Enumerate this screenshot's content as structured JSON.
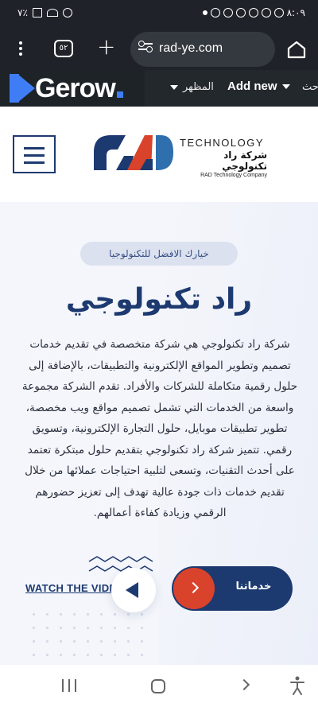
{
  "statusbar": {
    "time": "٨:٠٩",
    "battery": "٧٪"
  },
  "browser": {
    "tab_count": "٥٢",
    "url": "rad-ye.com"
  },
  "adminbar": {
    "logo_text": "Gerow",
    "appearance_label": "المظهر",
    "add_new_label": "Add new",
    "more_label": "حث"
  },
  "header": {
    "brand_en": "TECHNOLOGY",
    "brand_ar": "شركة راد تكنولوجي",
    "brand_small": "RAD Technology Company"
  },
  "hero": {
    "badge": "خيارك الافضل للتكنولوجيا",
    "title": "راد تكنولوجي",
    "description": "شركة راد تكنولوجي هي شركة متخصصة في تقديم خدمات تصميم وتطوير المواقع الإلكترونية والتطبيقات، بالإضافة إلى حلول رقمية متكاملة للشركات والأفراد. تقدم الشركة مجموعة واسعة من الخدمات التي تشمل تصميم مواقع ويب مخصصة، تطوير تطبيقات موبايل، حلول التجارة الإلكترونية، وتسويق رقمي. تتميز شركة راد تكنولوجي بتقديم حلول مبتكرة تعتمد على أحدث التقنيات، وتسعى لتلبية احتياجات عملائها من خلال تقديم خدمات ذات جودة عالية تهدف إلى تعزيز حضورهم الرقمي وزيادة كفاءة أعمالهم.",
    "watch_label": "WATCH THE VIDEO",
    "cta_label": "خدماتنا"
  },
  "colors": {
    "navy": "#1d3a70",
    "accent": "#d9432b",
    "gerow_blue": "#3f7df6"
  }
}
